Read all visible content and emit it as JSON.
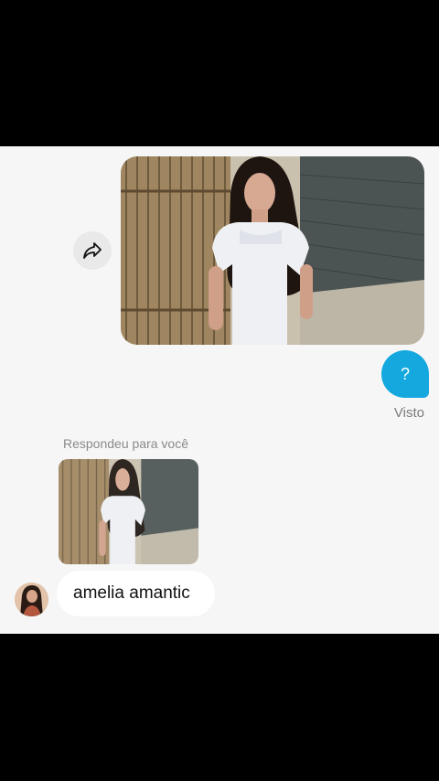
{
  "chat": {
    "sent_message": "?",
    "status": "Visto",
    "reply_label": "Respondeu para você",
    "received_message": "amelia amantic"
  },
  "icons": {
    "share": "share-forward-icon"
  },
  "colors": {
    "sent_bubble": "#14a8df",
    "chat_background": "#f6f6f6",
    "received_bubble": "#ffffff",
    "frame": "#000000"
  }
}
